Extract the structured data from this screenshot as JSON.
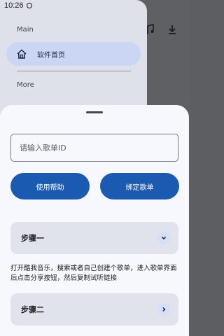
{
  "status_bar": {
    "time": "10:26"
  },
  "drawer": {
    "section_main": "Main",
    "nav_item_label": "软件首页",
    "section_more": "More"
  },
  "sheet": {
    "input_placeholder": "请输入歌单ID",
    "help_button": "使用帮助",
    "bind_button": "绑定歌单",
    "step1_title": "步骤一",
    "step1_description": "打开酷我音乐，搜索或者自己创建个歌单，进入歌单界面后点击分享按钮，然后复制试听链接",
    "step2_title": "步骤二"
  },
  "colors": {
    "primary": "#1b5ab1",
    "sheet_background": "#f7f8fd",
    "card_background": "#e0e2ec",
    "nav_highlight": "#cbd6f5"
  }
}
